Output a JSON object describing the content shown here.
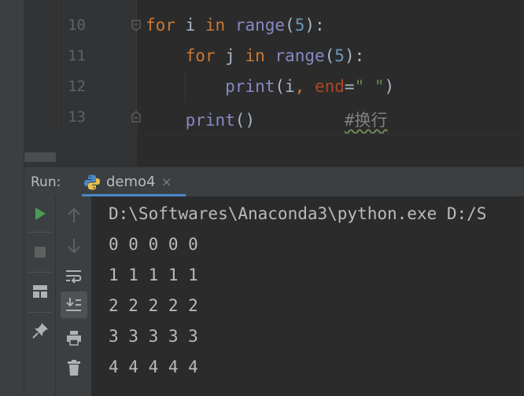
{
  "editor": {
    "lines": [
      {
        "number": "10",
        "tokens": [
          {
            "text": "for",
            "cls": "kw"
          },
          {
            "text": " i ",
            "cls": ""
          },
          {
            "text": "in",
            "cls": "kw"
          },
          {
            "text": " ",
            "cls": ""
          },
          {
            "text": "range",
            "cls": "fn"
          },
          {
            "text": "(",
            "cls": ""
          },
          {
            "text": "5",
            "cls": "num"
          },
          {
            "text": "):",
            "cls": ""
          }
        ]
      },
      {
        "number": "11",
        "tokens": [
          {
            "text": "    ",
            "cls": ""
          },
          {
            "text": "for",
            "cls": "kw"
          },
          {
            "text": " j ",
            "cls": ""
          },
          {
            "text": "in",
            "cls": "kw"
          },
          {
            "text": " ",
            "cls": ""
          },
          {
            "text": "range",
            "cls": "fn"
          },
          {
            "text": "(",
            "cls": ""
          },
          {
            "text": "5",
            "cls": "num"
          },
          {
            "text": "):",
            "cls": ""
          }
        ]
      },
      {
        "number": "12",
        "tokens": [
          {
            "text": "        ",
            "cls": ""
          },
          {
            "text": "print",
            "cls": "fn"
          },
          {
            "text": "(i",
            "cls": ""
          },
          {
            "text": ", ",
            "cls": "kw"
          },
          {
            "text": "end",
            "cls": "prm"
          },
          {
            "text": "=",
            "cls": ""
          },
          {
            "text": "\" \"",
            "cls": "str"
          },
          {
            "text": ")",
            "cls": ""
          }
        ]
      },
      {
        "number": "13",
        "tokens": [
          {
            "text": "    ",
            "cls": ""
          },
          {
            "text": "print",
            "cls": "fn"
          },
          {
            "text": "()",
            "cls": ""
          },
          {
            "text": "         ",
            "cls": ""
          },
          {
            "text": "#换行",
            "cls": "cmt"
          }
        ]
      }
    ]
  },
  "run": {
    "label": "Run:",
    "tab_label": "demo4",
    "tab_close": "×",
    "output": [
      "D:\\Softwares\\Anaconda3\\python.exe D:/S",
      "0 0 0 0 0",
      "1 1 1 1 1",
      "2 2 2 2 2",
      "3 3 3 3 3",
      "4 4 4 4 4"
    ]
  },
  "colors": {
    "keyword": "#cc7832",
    "builtin": "#8888c6",
    "number": "#6897bb",
    "string": "#6a8759",
    "accent": "#4a88c7",
    "run_green": "#499c54"
  },
  "icons": {
    "left_toolbar": [
      "run-icon",
      "stop-icon",
      "layout-icon",
      "pin-icon"
    ],
    "right_toolbar": [
      "up-arrow-icon",
      "down-arrow-icon",
      "soft-wrap-icon",
      "scroll-to-end-icon",
      "print-icon",
      "trash-icon"
    ]
  }
}
